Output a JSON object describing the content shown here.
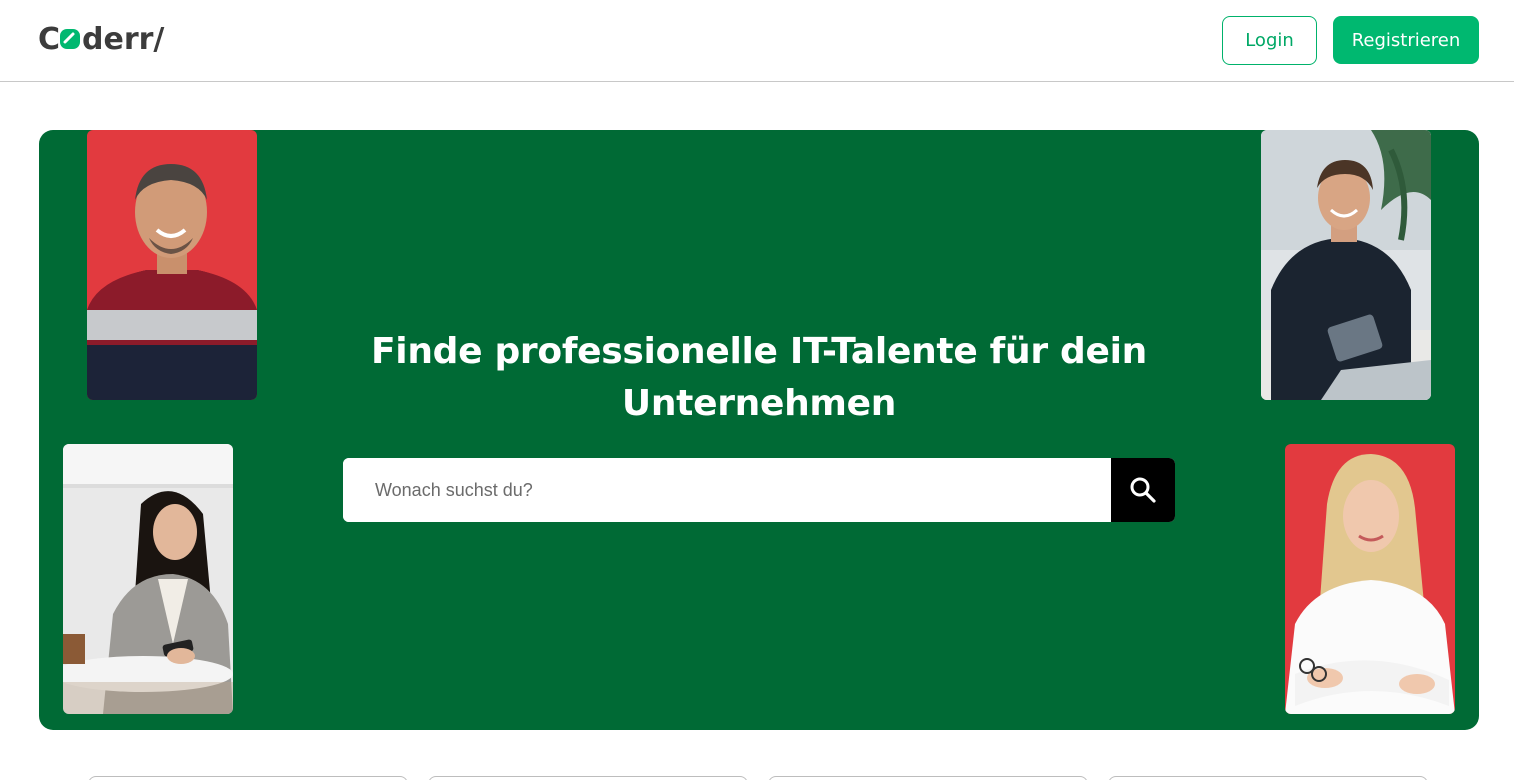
{
  "header": {
    "logo_text": "Coderr/",
    "login_label": "Login",
    "register_label": "Registrieren"
  },
  "hero": {
    "title": "Finde professionelle IT-Talente für dein Unternehmen",
    "search": {
      "placeholder": "Wonach suchst du?",
      "value": ""
    },
    "portraits": [
      {
        "name": "portrait-man-red-sweater"
      },
      {
        "name": "portrait-woman-phone"
      },
      {
        "name": "portrait-man-tablet"
      },
      {
        "name": "portrait-woman-crossed-arms"
      }
    ]
  },
  "colors": {
    "brand_green": "#00b870",
    "hero_bg": "#006a35",
    "portrait_red": "#e23a3f"
  },
  "icons": {
    "search": "search-icon",
    "logo": "coderr-logo-icon"
  }
}
